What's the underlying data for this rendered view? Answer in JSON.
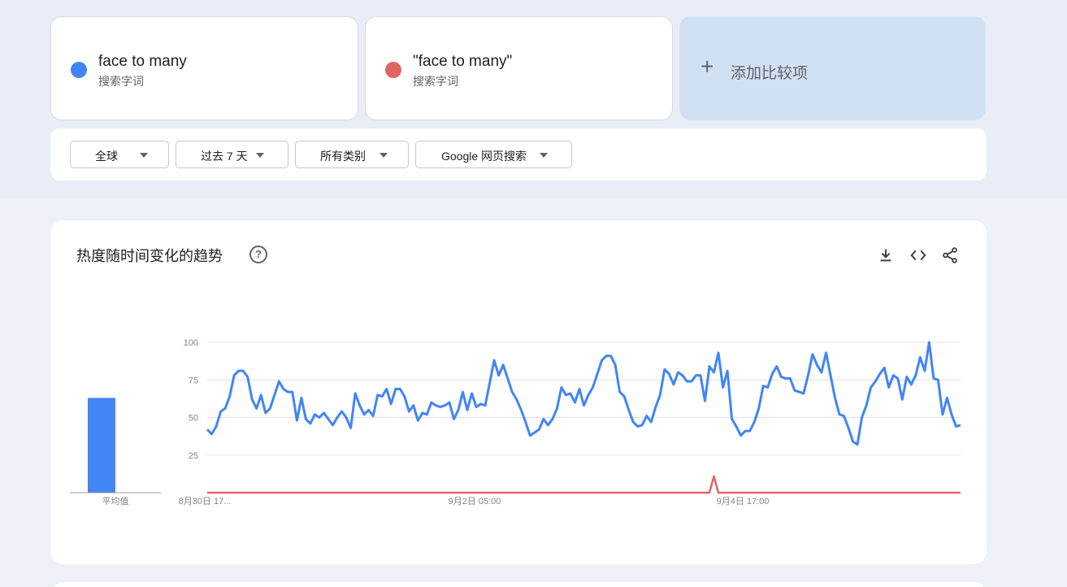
{
  "terms": [
    {
      "label": "face to many",
      "type": "搜索字词",
      "color": "#4285f4"
    },
    {
      "label": "\"face to many\"",
      "type": "搜索字词",
      "color": "#e06666"
    }
  ],
  "add_compare": {
    "label": "添加比较项",
    "icon": "plus-icon"
  },
  "filters": {
    "region": "全球",
    "time": "过去 7 天",
    "category": "所有类别",
    "property": "Google 网页搜索"
  },
  "chart_card": {
    "title": "热度随时间变化的趋势",
    "help_icon": "?",
    "actions": [
      "download-icon",
      "embed-code-icon",
      "share-icon"
    ]
  },
  "chart_data": {
    "type": "line",
    "x_ticks": [
      "8月30日 17...",
      "9月2日 05:00",
      "9月4日 17:00"
    ],
    "ylim": [
      0,
      100
    ],
    "y_ticks": [
      25,
      50,
      75,
      100
    ],
    "grid": true,
    "series": [
      {
        "name": "face to many",
        "color": "#4285f4",
        "values": [
          42,
          39,
          44,
          54,
          56,
          64,
          78,
          81,
          81,
          77,
          62,
          56,
          65,
          53,
          56,
          65,
          74,
          69,
          67,
          67,
          48,
          63,
          49,
          46,
          52,
          50,
          53,
          49,
          45,
          50,
          54,
          50,
          43,
          66,
          58,
          52,
          55,
          51,
          65,
          64,
          69,
          59,
          69,
          69,
          64,
          54,
          58,
          48,
          53,
          52,
          60,
          58,
          57,
          58,
          60,
          49,
          55,
          67,
          55,
          66,
          57,
          59,
          58,
          73,
          88,
          78,
          85,
          76,
          67,
          62,
          55,
          47,
          38,
          40,
          42,
          49,
          45,
          49,
          56,
          70,
          65,
          66,
          60,
          69,
          58,
          65,
          70,
          79,
          88,
          91,
          91,
          85,
          67,
          64,
          55,
          47,
          44,
          45,
          51,
          47,
          57,
          65,
          82,
          79,
          72,
          80,
          78,
          74,
          74,
          78,
          78,
          61,
          84,
          80,
          93,
          70,
          81,
          49,
          44,
          38,
          41,
          41,
          47,
          56,
          71,
          70,
          79,
          84,
          77,
          76,
          76,
          68,
          67,
          66,
          78,
          92,
          85,
          80,
          93,
          78,
          63,
          52,
          51,
          43,
          34,
          32,
          50,
          58,
          70,
          74,
          79,
          83,
          70,
          78,
          76,
          62,
          77,
          72,
          78,
          90,
          81,
          100,
          76,
          75,
          52,
          63,
          52,
          44,
          45
        ],
        "average": 63
      },
      {
        "name": "\"face to many\"",
        "color": "#e06666",
        "values": [
          0,
          0,
          0,
          0,
          0,
          0,
          0,
          0,
          0,
          0,
          0,
          0,
          0,
          0,
          0,
          0,
          0,
          0,
          0,
          0,
          0,
          0,
          0,
          0,
          0,
          0,
          0,
          0,
          0,
          0,
          0,
          0,
          0,
          0,
          0,
          0,
          0,
          0,
          0,
          0,
          0,
          0,
          0,
          0,
          0,
          0,
          0,
          0,
          0,
          0,
          0,
          0,
          0,
          0,
          0,
          0,
          0,
          0,
          0,
          0,
          0,
          0,
          0,
          0,
          0,
          0,
          0,
          0,
          0,
          0,
          0,
          0,
          0,
          0,
          0,
          0,
          0,
          0,
          0,
          0,
          0,
          0,
          0,
          0,
          0,
          0,
          0,
          0,
          0,
          0,
          0,
          0,
          0,
          0,
          0,
          0,
          0,
          0,
          0,
          0,
          0,
          0,
          0,
          0,
          0,
          0,
          0,
          0,
          0,
          0,
          0,
          0,
          0,
          11,
          0,
          0,
          0,
          0,
          0,
          0,
          0,
          0,
          0,
          0,
          0,
          0,
          0,
          0,
          0,
          0,
          0,
          0,
          0,
          0,
          0,
          0,
          0,
          0,
          0,
          0,
          0,
          0,
          0,
          0,
          0,
          0,
          0,
          0,
          0,
          0,
          0,
          0,
          0,
          0,
          0,
          0,
          0,
          0,
          0,
          0,
          0,
          0,
          0,
          0,
          0,
          0,
          0,
          0,
          0
        ],
        "average": 0
      }
    ],
    "average_label": "平均值"
  }
}
